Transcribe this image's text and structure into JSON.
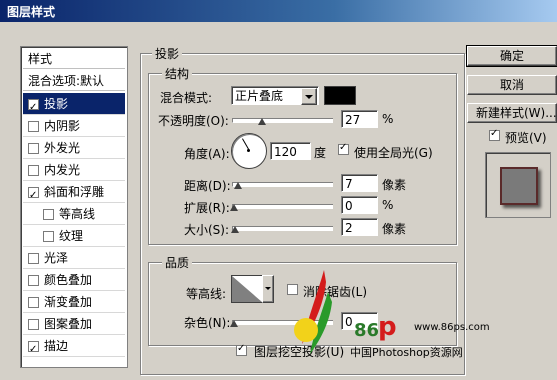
{
  "window": {
    "title": "图层样式"
  },
  "sidebar": {
    "styles_header": "样式",
    "blend_header": "混合选项:默认",
    "items": [
      {
        "label": "投影",
        "checked": true,
        "selected": true
      },
      {
        "label": "内阴影",
        "checked": false
      },
      {
        "label": "外发光",
        "checked": false
      },
      {
        "label": "内发光",
        "checked": false
      },
      {
        "label": "斜面和浮雕",
        "checked": true
      },
      {
        "label": "等高线",
        "checked": false
      },
      {
        "label": "纹理",
        "checked": false
      },
      {
        "label": "光泽",
        "checked": false
      },
      {
        "label": "颜色叠加",
        "checked": false
      },
      {
        "label": "渐变叠加",
        "checked": false
      },
      {
        "label": "图案叠加",
        "checked": false
      },
      {
        "label": "描边",
        "checked": true
      }
    ]
  },
  "panel": {
    "title": "投影",
    "structure": {
      "title": "结构",
      "blend_mode_label": "混合模式:",
      "blend_mode_value": "正片叠底",
      "blend_color": "#000000",
      "opacity_label": "不透明度(O):",
      "opacity_value": "27",
      "opacity_unit": "%",
      "angle_label": "角度(A):",
      "angle_value": "120",
      "angle_unit": "度",
      "global_light_label": "使用全局光(G)",
      "global_light_checked": true,
      "distance_label": "距离(D):",
      "distance_value": "7",
      "distance_unit": "像素",
      "spread_label": "扩展(R):",
      "spread_value": "0",
      "spread_unit": "%",
      "size_label": "大小(S):",
      "size_value": "2",
      "size_unit": "像素"
    },
    "quality": {
      "title": "品质",
      "contour_label": "等高线:",
      "antialias_label": "消除锯齿(L)",
      "antialias_checked": false,
      "noise_label": "杂色(N):",
      "noise_value": "0",
      "knockout_label": "图层挖空投影(U)",
      "knockout_checked": true
    }
  },
  "buttons": {
    "ok": "确定",
    "cancel": "取消",
    "new_style": "新建样式(W)...",
    "preview_label": "预览(V)",
    "preview_checked": true
  },
  "watermark": {
    "url": "www.86ps.com",
    "brand": "中国Photoshop资源网",
    "logo_number": "86"
  }
}
